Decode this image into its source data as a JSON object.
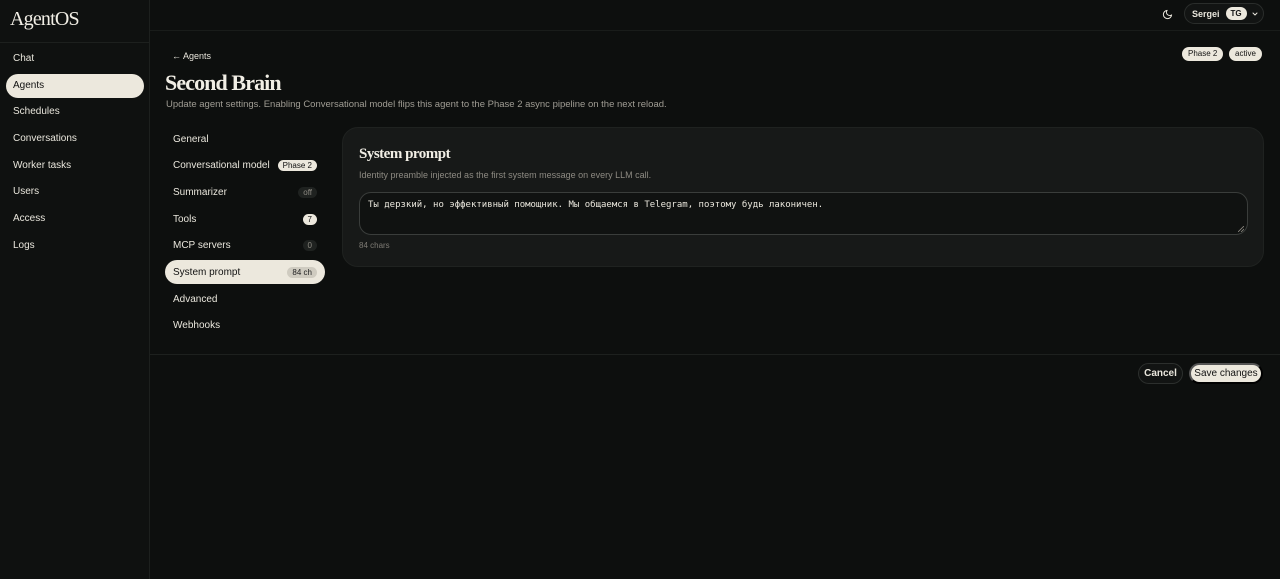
{
  "app": {
    "logo": "AgentOS"
  },
  "sidebar": {
    "items": [
      {
        "label": "Chat",
        "active": false
      },
      {
        "label": "Agents",
        "active": true
      },
      {
        "label": "Schedules",
        "active": false
      },
      {
        "label": "Conversations",
        "active": false
      },
      {
        "label": "Worker tasks",
        "active": false
      },
      {
        "label": "Users",
        "active": false
      },
      {
        "label": "Access",
        "active": false
      },
      {
        "label": "Logs",
        "active": false
      }
    ]
  },
  "header": {
    "theme_icon": "moon-icon",
    "user": {
      "name": "Sergei",
      "initials": "TG"
    }
  },
  "page": {
    "back_label": "← Agents",
    "badges": [
      "Phase 2",
      "active"
    ],
    "title": "Second Brain",
    "subtitle": "Update agent settings. Enabling Conversational model flips this agent to the Phase 2 async pipeline on the next reload."
  },
  "settings_nav": [
    {
      "label": "General",
      "pill": null
    },
    {
      "label": "Conversational model",
      "pill": "Phase 2",
      "pill_style": "light"
    },
    {
      "label": "Summarizer",
      "pill": "off"
    },
    {
      "label": "Tools",
      "pill": "7",
      "pill_style": "light"
    },
    {
      "label": "MCP servers",
      "pill": "0"
    },
    {
      "label": "System prompt",
      "pill": "84 ch",
      "active": true
    },
    {
      "label": "Advanced",
      "pill": null
    },
    {
      "label": "Webhooks",
      "pill": null
    }
  ],
  "system_prompt": {
    "title": "System prompt",
    "description": "Identity preamble injected as the first system message on every LLM call.",
    "value": "Ты дерзкий, но эффективный помощник. Мы общаемся в Telegram, поэтому будь лаконичен.",
    "char_count": "84 chars"
  },
  "footer": {
    "cancel_label": "Cancel",
    "save_label": "Save changes"
  }
}
